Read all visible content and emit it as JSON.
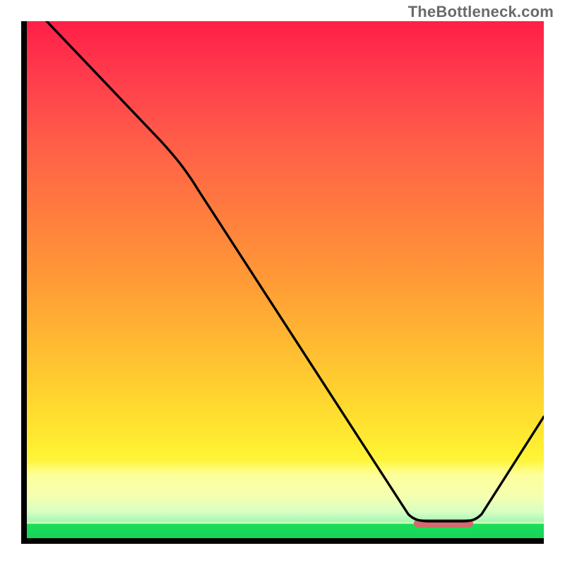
{
  "watermark": "TheBottleneck.com",
  "chart_data": {
    "type": "line",
    "title": "",
    "xlabel": "",
    "ylabel": "",
    "xlim": [
      0,
      100
    ],
    "ylim": [
      0,
      100
    ],
    "gradient_background": {
      "orientation": "vertical",
      "stops": [
        {
          "pos": 0,
          "color": "#ff1f47"
        },
        {
          "pos": 50,
          "color": "#ff9a36"
        },
        {
          "pos": 83,
          "color": "#fff032"
        },
        {
          "pos": 92,
          "color": "#f4ffb0"
        },
        {
          "pos": 97,
          "color": "#1adf5b"
        },
        {
          "pos": 100,
          "color": "#17d457"
        }
      ]
    },
    "series": [
      {
        "name": "bottleneck-curve",
        "x": [
          4,
          26,
          33,
          74,
          78,
          84,
          88,
          100
        ],
        "values": [
          100,
          77,
          68,
          5,
          3,
          3,
          5,
          24
        ]
      }
    ],
    "optimum_range_x": [
      75,
      86
    ],
    "optimum_marker_color": "#d26a6e",
    "annotations": []
  }
}
